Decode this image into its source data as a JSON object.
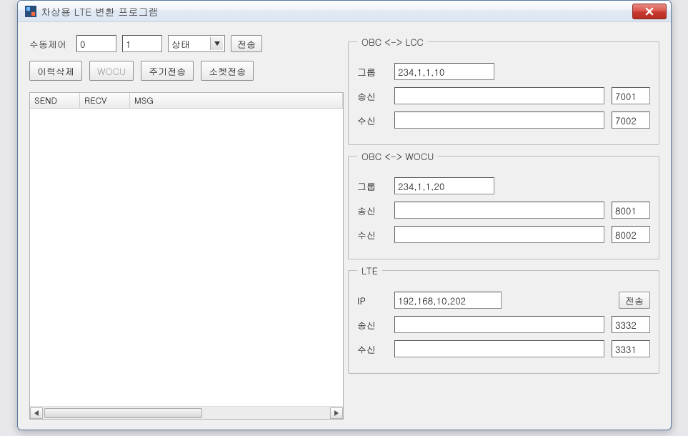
{
  "title": "차상용 LTE 변환 프로그램",
  "left": {
    "manual_label": "수동제어",
    "manual_a": "0",
    "manual_b": "1",
    "combo_value": "상태",
    "btn_send": "전송",
    "btn_history_delete": "이력삭제",
    "btn_wocu": "WOCU",
    "btn_periodic": "주기전송",
    "btn_socket": "소켓전송",
    "columns": {
      "send": "SEND",
      "recv": "RECV",
      "msg": "MSG"
    }
  },
  "obc_lcc": {
    "legend": "OBC <-> LCC",
    "group_label": "그룹",
    "group_value": "234,1,1,10",
    "send_label": "송신",
    "send_value": "",
    "send_port": "7001",
    "recv_label": "수신",
    "recv_value": "",
    "recv_port": "7002"
  },
  "obc_wocu": {
    "legend": "OBC <-> WOCU",
    "group_label": "그룹",
    "group_value": "234,1,1,20",
    "send_label": "송신",
    "send_value": "",
    "send_port": "8001",
    "recv_label": "수신",
    "recv_value": "",
    "recv_port": "8002"
  },
  "lte": {
    "legend": "LTE",
    "ip_label": "IP",
    "ip_value": "192,168,10,202",
    "btn_send": "전송",
    "send_label": "송신",
    "send_value": "",
    "send_port": "3332",
    "recv_label": "수신",
    "recv_value": "",
    "recv_port": "3331"
  }
}
